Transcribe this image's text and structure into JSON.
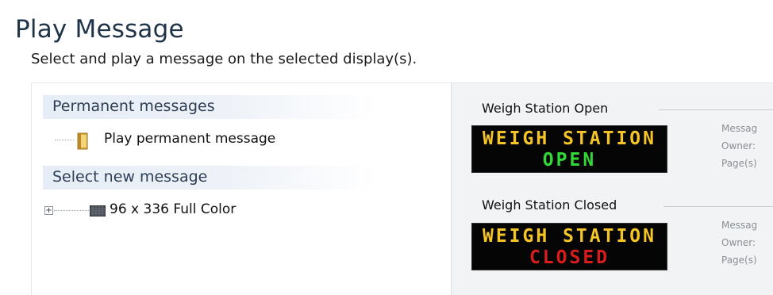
{
  "page": {
    "title": "Play Message",
    "subtitle": "Select and play a message on the selected display(s)."
  },
  "left_tree": {
    "permanent_header": "Permanent messages",
    "play_permanent_label": "Play permanent message",
    "new_header": "Select new message",
    "display_node_label": "96 x 336 Full Color",
    "expander_glyph": "+"
  },
  "previews": [
    {
      "label": "Weigh Station Open",
      "line1": "WEIGH STATION",
      "line2": "OPEN",
      "line2_color": "#31d838",
      "meta": [
        "Messag",
        "Owner:",
        "Page(s)"
      ]
    },
    {
      "label": "Weigh Station Closed",
      "line1": "WEIGH STATION",
      "line2": "CLOSED",
      "line2_color": "#d91d1d",
      "meta": [
        "Messag",
        "Owner:",
        "Page(s)"
      ]
    }
  ],
  "colors": {
    "title": "#1f3349",
    "led_amber": "#f5c528",
    "panel_bg": "#f2f3f5"
  }
}
